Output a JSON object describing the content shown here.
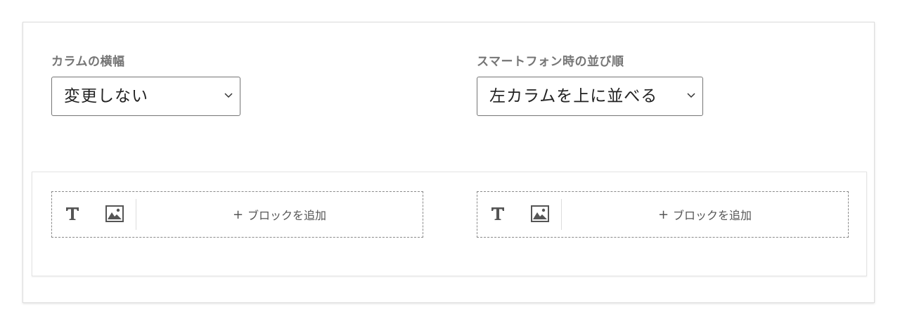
{
  "column_width": {
    "label": "カラムの横幅",
    "selected": "変更しない"
  },
  "smartphone_order": {
    "label": "スマートフォン時の並び順",
    "selected": "左カラムを上に並べる"
  },
  "columns": [
    {
      "add_block_label": "ブロックを追加",
      "plus": "+"
    },
    {
      "add_block_label": "ブロックを追加",
      "plus": "+"
    }
  ],
  "icons": {
    "text": "text-T-icon",
    "image": "image-icon",
    "dropdown": "chevron-down-icon"
  },
  "colors": {
    "label_text": "#757575",
    "border": "#757575",
    "icon": "#555555"
  }
}
